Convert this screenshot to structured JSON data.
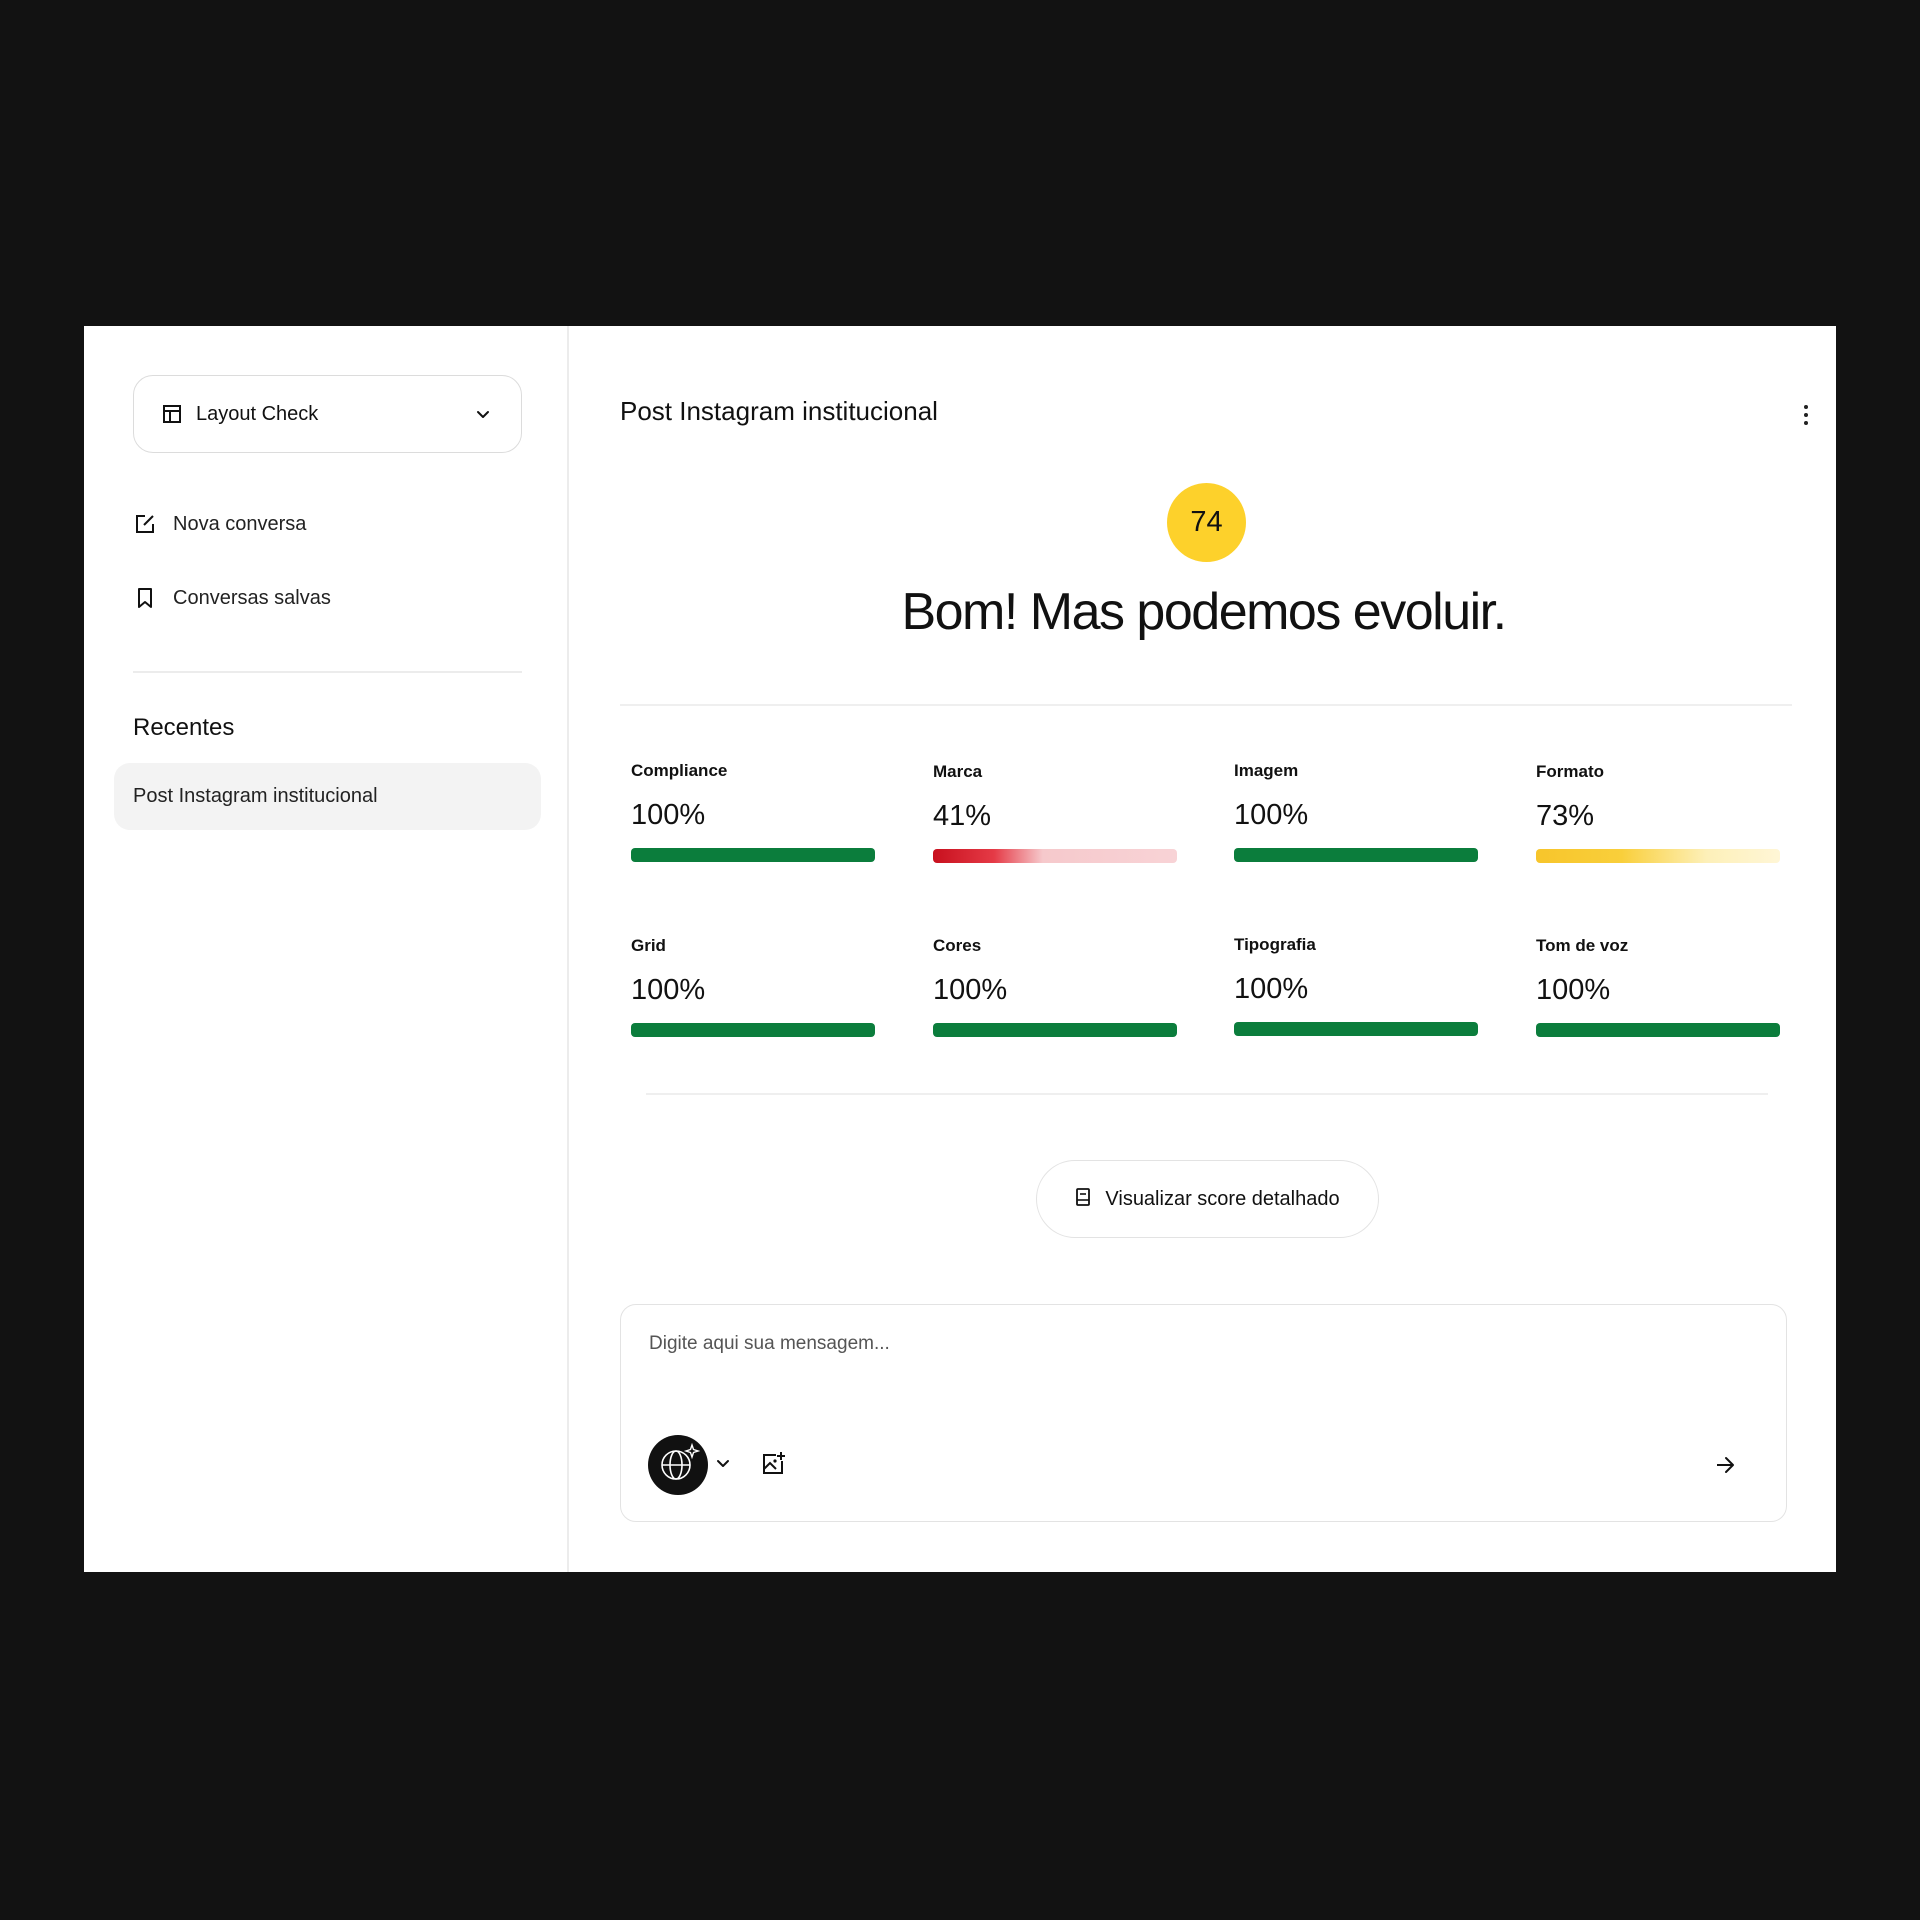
{
  "sidebar": {
    "app_selector": {
      "label": "Layout Check",
      "icon": "layout-icon"
    },
    "nav": [
      {
        "label": "Nova conversa",
        "icon": "edit-icon"
      },
      {
        "label": "Conversas salvas",
        "icon": "bookmark-icon"
      }
    ],
    "recent_heading": "Recentes",
    "recent_items": [
      {
        "label": "Post Instagram institucional"
      }
    ]
  },
  "main": {
    "title": "Post Instagram institucional",
    "score": "74",
    "headline": "Bom! Mas podemos evoluir.",
    "metrics": [
      {
        "label": "Compliance",
        "value": "100%",
        "fill": 1.0,
        "color": "#0b7d3c"
      },
      {
        "label": "Marca",
        "value": "41%",
        "fill": 0.41,
        "color": "#c8101e"
      },
      {
        "label": "Imagem",
        "value": "100%",
        "fill": 1.0,
        "color": "#0b7d3c"
      },
      {
        "label": "Formato",
        "value": "73%",
        "fill": 0.73,
        "color": "#f7c52b"
      },
      {
        "label": "Grid",
        "value": "100%",
        "fill": 1.0,
        "color": "#0b7d3c"
      },
      {
        "label": "Cores",
        "value": "100%",
        "fill": 1.0,
        "color": "#0b7d3c"
      },
      {
        "label": "Tipografia",
        "value": "100%",
        "fill": 1.0,
        "color": "#0b7d3c"
      },
      {
        "label": "Tom de voz",
        "value": "100%",
        "fill": 1.0,
        "color": "#0b7d3c"
      }
    ],
    "detail_button": "Visualizar score detalhado",
    "composer": {
      "placeholder": "Digite aqui sua mensagem..."
    }
  },
  "colors": {
    "score_badge": "#fdd12b",
    "ok": "#0b7d3c",
    "bad": "#c8101e",
    "warn": "#f7c52b"
  }
}
